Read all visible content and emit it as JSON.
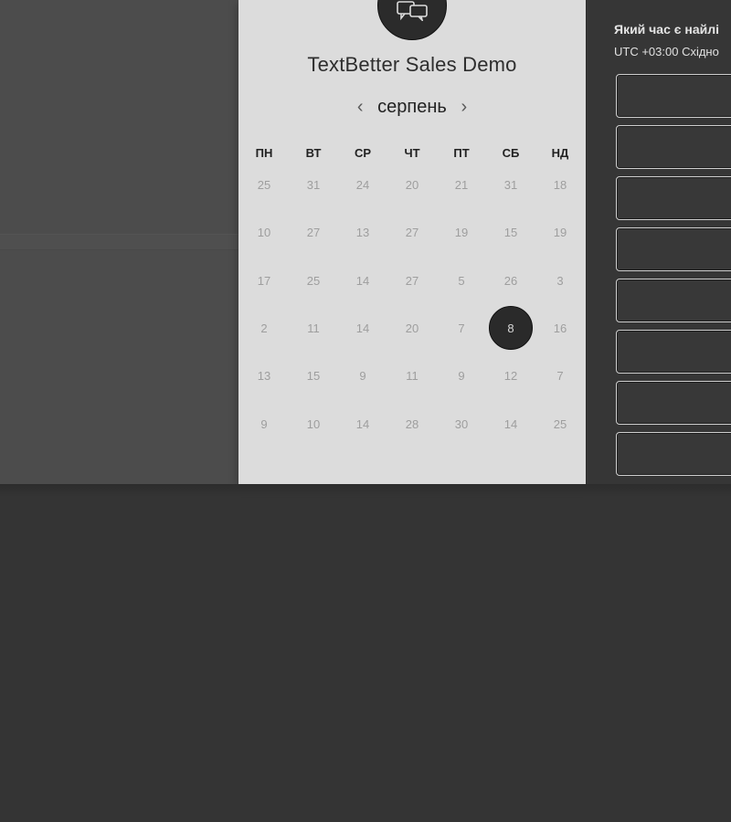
{
  "event": {
    "title": "TextBetter Sales Demo",
    "avatar_icon": "chat-bubbles-icon"
  },
  "calendar": {
    "month": "серпень",
    "prev_icon": "‹",
    "next_icon": "›",
    "weekdays": [
      "ПН",
      "ВТ",
      "СР",
      "ЧТ",
      "ПТ",
      "СБ",
      "НД"
    ],
    "weeks": [
      [
        "25",
        "31",
        "24",
        "20",
        "21",
        "31",
        "18"
      ],
      [
        "10",
        "27",
        "13",
        "27",
        "19",
        "15",
        "19"
      ],
      [
        "17",
        "25",
        "14",
        "27",
        "5",
        "26",
        "3"
      ],
      [
        "2",
        "11",
        "14",
        "20",
        "7",
        "8",
        "16"
      ],
      [
        "13",
        "15",
        "9",
        "11",
        "9",
        "12",
        "7"
      ],
      [
        "9",
        "10",
        "14",
        "28",
        "30",
        "14",
        "25"
      ]
    ],
    "selected": {
      "week": 3,
      "day": 5
    }
  },
  "time_panel": {
    "title": "Який час є найлі",
    "timezone": "UTC +03:00 Східно",
    "slot_count_visible": 8
  },
  "colors": {
    "card": "#dcdcdc",
    "selected_day": "#2a2a2a",
    "day_text": "#9e9e9e"
  }
}
